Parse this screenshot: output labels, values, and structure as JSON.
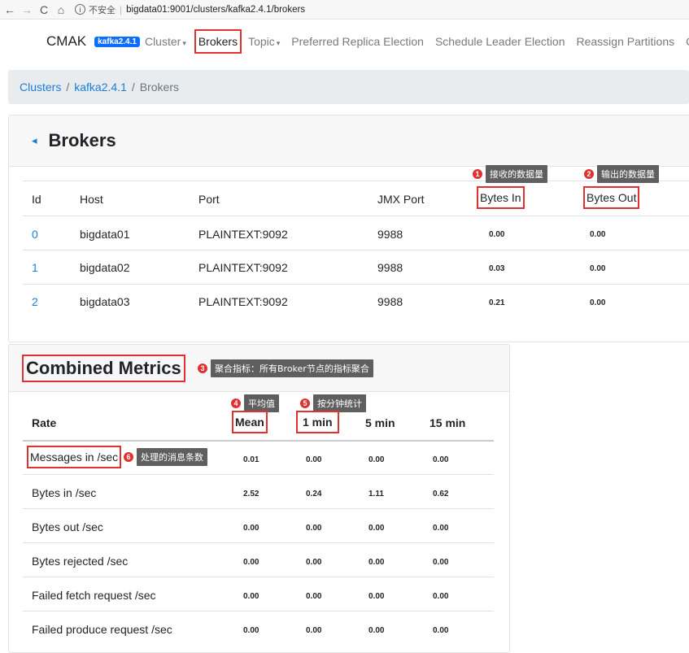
{
  "browser": {
    "back": "←",
    "forward": "→",
    "reload": "C",
    "home": "⌂",
    "info": "i",
    "insecure": "不安全",
    "separator": "|",
    "url": "bigdata01:9001/clusters/kafka2.4.1/brokers"
  },
  "navbar": {
    "brand": "CMAK",
    "version": "kafka2.4.1",
    "items": [
      {
        "label": "Cluster",
        "caret": "▾"
      },
      {
        "label": "Brokers"
      },
      {
        "label": "Topic",
        "caret": "▾"
      },
      {
        "label": "Preferred Replica Election"
      },
      {
        "label": "Schedule Leader Election"
      },
      {
        "label": "Reassign Partitions"
      },
      {
        "label": "C"
      }
    ]
  },
  "breadcrumb": {
    "items": [
      "Clusters",
      "kafka2.4.1"
    ],
    "separator": "/",
    "current": "Brokers"
  },
  "brokers": {
    "back_icon": "◂",
    "title": "Brokers",
    "columns": [
      "Id",
      "Host",
      "Port",
      "JMX Port",
      "Bytes In",
      "Bytes Out"
    ],
    "rows": [
      {
        "id": "0",
        "host": "bigdata01",
        "port": "PLAINTEXT:9092",
        "jmx": "9988",
        "bytes_in": "0.00",
        "bytes_out": "0.00"
      },
      {
        "id": "1",
        "host": "bigdata02",
        "port": "PLAINTEXT:9092",
        "jmx": "9988",
        "bytes_in": "0.03",
        "bytes_out": "0.00"
      },
      {
        "id": "2",
        "host": "bigdata03",
        "port": "PLAINTEXT:9092",
        "jmx": "9988",
        "bytes_in": "0.21",
        "bytes_out": "0.00"
      }
    ]
  },
  "annotations": {
    "a1": {
      "num": "1",
      "text": "接收的数据量"
    },
    "a2": {
      "num": "2",
      "text": "输出的数据量"
    },
    "a3": {
      "num": "3",
      "text": "聚合指标：所有Broker节点的指标聚合"
    },
    "a4": {
      "num": "4",
      "text": "平均值"
    },
    "a5": {
      "num": "5",
      "text": "按分钟统计"
    },
    "a6": {
      "num": "6",
      "text": "处理的消息条数"
    }
  },
  "metrics": {
    "title": "Combined Metrics",
    "columns": [
      "Rate",
      "Mean",
      "1 min",
      "5 min",
      "15 min"
    ],
    "rows": [
      {
        "rate": "Messages in /sec",
        "mean": "0.01",
        "m1": "0.00",
        "m5": "0.00",
        "m15": "0.00"
      },
      {
        "rate": "Bytes in /sec",
        "mean": "2.52",
        "m1": "0.24",
        "m5": "1.11",
        "m15": "0.62"
      },
      {
        "rate": "Bytes out /sec",
        "mean": "0.00",
        "m1": "0.00",
        "m5": "0.00",
        "m15": "0.00"
      },
      {
        "rate": "Bytes rejected /sec",
        "mean": "0.00",
        "m1": "0.00",
        "m5": "0.00",
        "m15": "0.00"
      },
      {
        "rate": "Failed fetch request /sec",
        "mean": "0.00",
        "m1": "0.00",
        "m5": "0.00",
        "m15": "0.00"
      },
      {
        "rate": "Failed produce request /sec",
        "mean": "0.00",
        "m1": "0.00",
        "m5": "0.00",
        "m15": "0.00"
      }
    ]
  }
}
